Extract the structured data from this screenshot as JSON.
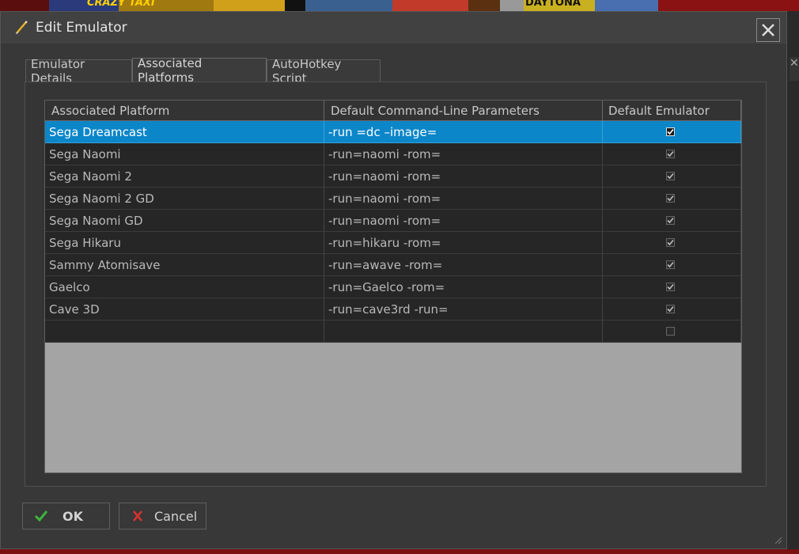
{
  "window": {
    "title": "Edit Emulator"
  },
  "tabs": [
    {
      "label": "Emulator Details"
    },
    {
      "label": "Associated Platforms"
    },
    {
      "label": "AutoHotkey Script"
    }
  ],
  "table": {
    "columns": [
      "Associated Platform",
      "Default Command-Line Parameters",
      "Default Emulator"
    ],
    "rows": [
      {
        "platform": "Sega Dreamcast",
        "params": "-run =dc –image=",
        "default": true,
        "selected": true
      },
      {
        "platform": "Sega Naomi",
        "params": "-run=naomi -rom=",
        "default": true
      },
      {
        "platform": "Sega Naomi 2",
        "params": "-run=naomi -rom=",
        "default": true
      },
      {
        "platform": "Sega Naomi 2 GD",
        "params": "-run=naomi -rom=",
        "default": true
      },
      {
        "platform": "Sega Naomi GD",
        "params": "-run=naomi -rom=",
        "default": true
      },
      {
        "platform": "Sega Hikaru",
        "params": "-run=hikaru -rom=",
        "default": true
      },
      {
        "platform": "Sammy Atomisave",
        "params": "-run=awave -rom=",
        "default": true
      },
      {
        "platform": "Gaelco",
        "params": "-run=Gaelco -rom=",
        "default": true
      },
      {
        "platform": "Cave 3D",
        "params": "-run=cave3rd -run=",
        "default": true
      },
      {
        "platform": "",
        "params": "",
        "default": false
      }
    ]
  },
  "buttons": {
    "ok": "OK",
    "cancel": "Cancel"
  },
  "background": {
    "banner_left": "CRAZY TAXI",
    "banner_right": "DAYTONA"
  },
  "colors": {
    "selection": "#0b86c9",
    "ok_icon": "#3cb43c",
    "cancel_icon": "#d23232"
  },
  "icons": {
    "title": "pencil-icon",
    "close": "close-icon",
    "ok": "checkmark-icon",
    "cancel": "x-icon"
  }
}
